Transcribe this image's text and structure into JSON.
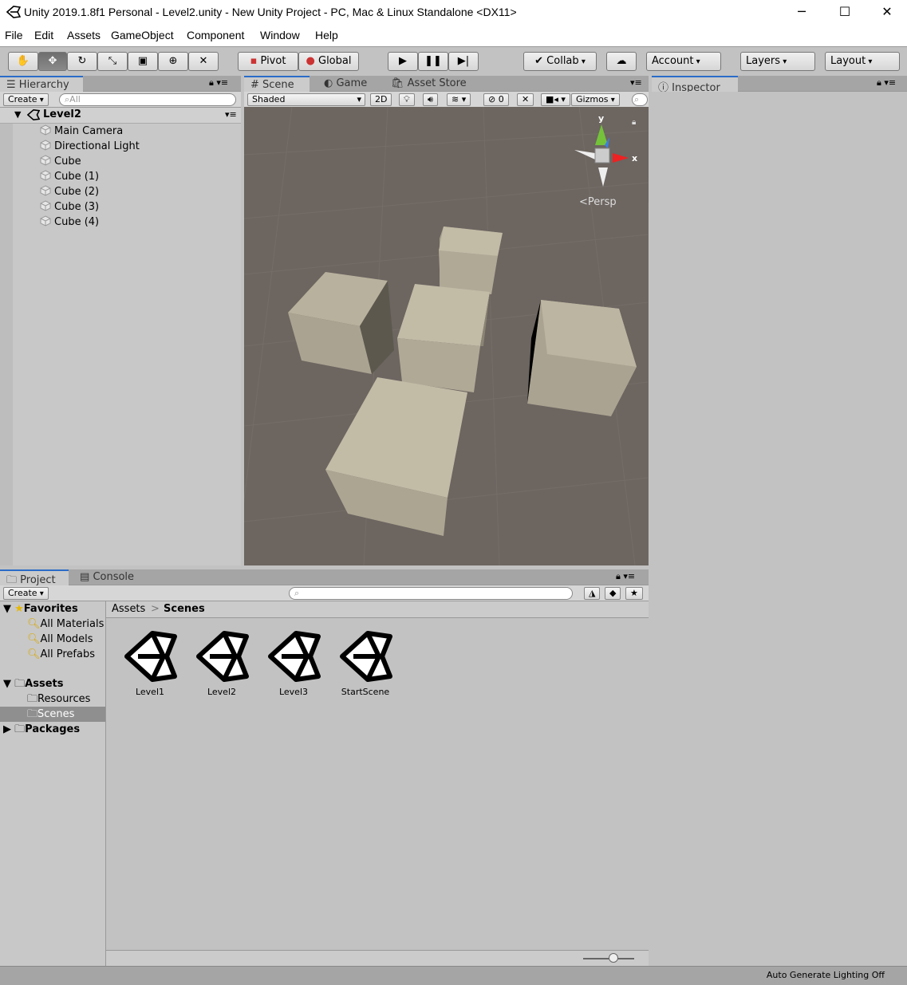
{
  "window": {
    "title": "Unity 2019.1.8f1 Personal - Level2.unity - New Unity Project - PC, Mac & Linux Standalone <DX11>",
    "minimize": "─",
    "maximize": "☐",
    "close": "✕"
  },
  "menu": [
    "File",
    "Edit",
    "Assets",
    "GameObject",
    "Component",
    "Window",
    "Help"
  ],
  "toolbar": {
    "pivot": "Pivot",
    "global": "Global",
    "collab": "Collab",
    "account": "Account",
    "layers": "Layers",
    "layout": "Layout"
  },
  "hierarchy": {
    "tab": "Hierarchy",
    "create": "Create",
    "search_placeholder": "All",
    "scene_name": "Level2",
    "items": [
      "Main Camera",
      "Directional Light",
      "Cube",
      "Cube (1)",
      "Cube (2)",
      "Cube (3)",
      "Cube (4)"
    ]
  },
  "scene_view": {
    "tabs": [
      "Scene",
      "Game",
      "Asset Store"
    ],
    "shading": "Shaded",
    "mode_2d": "2D",
    "hidden_count": "0",
    "gizmos": "Gizmos",
    "projection": "Persp",
    "axis_y": "y",
    "axis_x": "x"
  },
  "inspector": {
    "tab": "Inspector"
  },
  "project": {
    "tabs": [
      "Project",
      "Console"
    ],
    "create": "Create",
    "favorites": {
      "label": "Favorites",
      "items": [
        "All Materials",
        "All Models",
        "All Prefabs"
      ]
    },
    "assets": {
      "label": "Assets",
      "children": [
        "Resources",
        "Scenes"
      ]
    },
    "packages": "Packages",
    "breadcrumb": [
      "Assets",
      "Scenes"
    ],
    "scenes": [
      "Level1",
      "Level2",
      "Level3",
      "StartScene"
    ]
  },
  "status": {
    "text": "Auto Generate Lighting Off"
  }
}
